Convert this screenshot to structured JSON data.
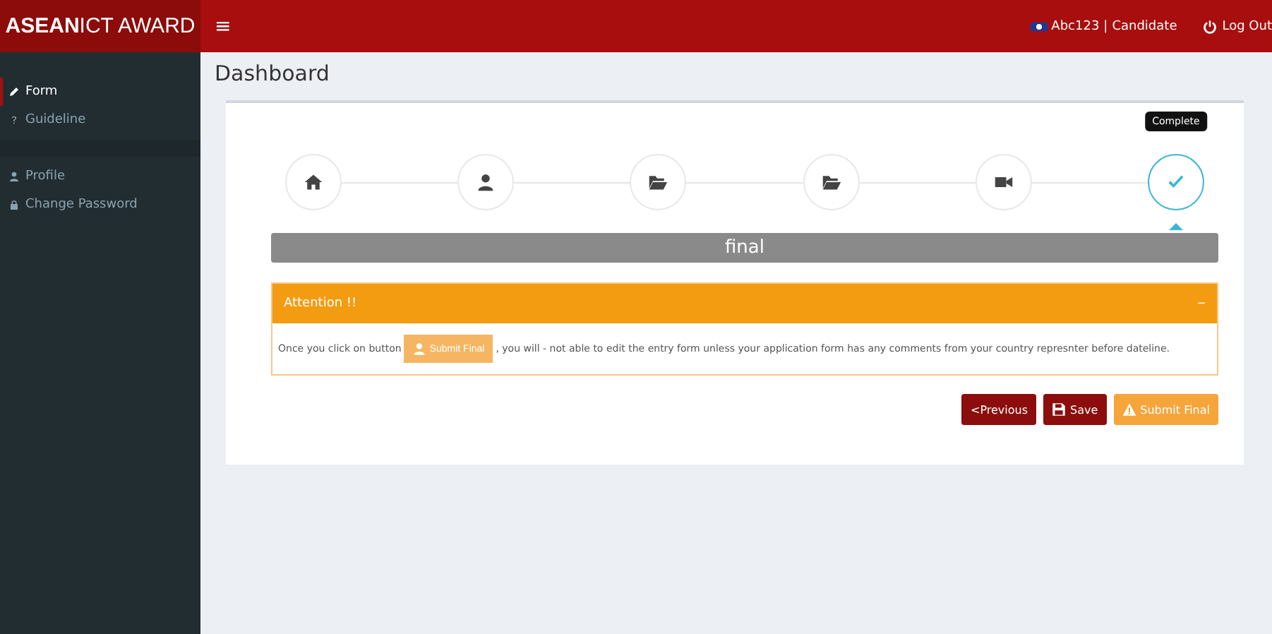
{
  "header": {
    "logo_bold": "ASEAN",
    "logo_rest": "ICT AWARD",
    "menu_toggle": "≡",
    "user": "Abc123",
    "separator": "|",
    "role": "Candidate",
    "logout": "Log Out"
  },
  "sidebar": {
    "groups": [
      [
        {
          "label": "Form",
          "kind": "pencil",
          "selected": true
        },
        {
          "label": "Guideline",
          "kind": "question",
          "selected": false
        }
      ],
      [
        {
          "label": "Profile",
          "kind": "user",
          "selected": false
        },
        {
          "label": "Change Password",
          "kind": "lock",
          "selected": false
        }
      ]
    ]
  },
  "page_title": "Dashboard",
  "steps": [
    {
      "kind": "home",
      "selected": false
    },
    {
      "kind": "user",
      "selected": false
    },
    {
      "kind": "folder",
      "selected": false
    },
    {
      "kind": "folder",
      "selected": false
    },
    {
      "kind": "video",
      "selected": false
    },
    {
      "kind": "check",
      "selected": true,
      "tooltip": "Complete"
    }
  ],
  "section_title": "final",
  "attention": {
    "title": "Attention !!",
    "collapse": "−",
    "text_before": "Once you click on button",
    "inline_button": "Submit Final",
    "text_after": ", you will - not able to edit the entry form unless your application form has any comments from your country represnter before dateline."
  },
  "buttons": [
    {
      "label": "<Previous",
      "kind": "previous"
    },
    {
      "label": "Save",
      "kind": "save"
    },
    {
      "label": "Submit Final",
      "kind": "submit"
    }
  ]
}
